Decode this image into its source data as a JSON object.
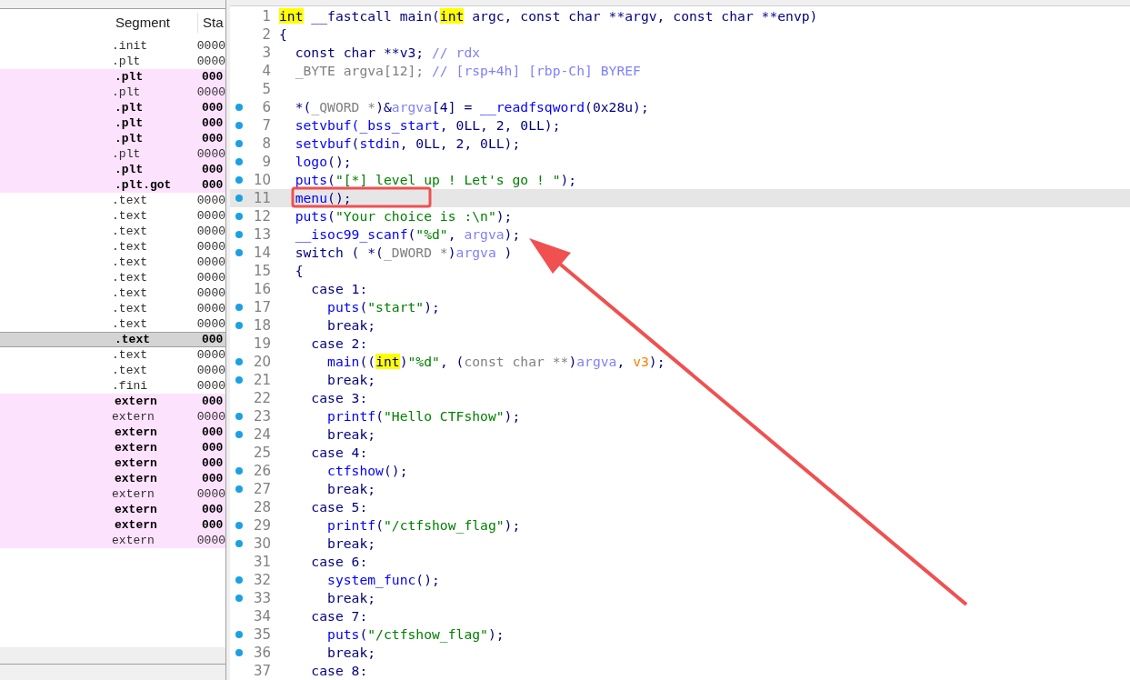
{
  "segments_table": {
    "columns": [
      "Segment",
      "Sta"
    ],
    "rows": [
      {
        "segment": ".init",
        "start": "0000",
        "bold": false,
        "imported": false,
        "selected": false
      },
      {
        "segment": ".plt",
        "start": "0000",
        "bold": false,
        "imported": false,
        "selected": false
      },
      {
        "segment": ".plt",
        "start": "000",
        "bold": true,
        "imported": true,
        "selected": false
      },
      {
        "segment": ".plt",
        "start": "0000",
        "bold": false,
        "imported": true,
        "selected": false
      },
      {
        "segment": ".plt",
        "start": "000",
        "bold": true,
        "imported": true,
        "selected": false
      },
      {
        "segment": ".plt",
        "start": "000",
        "bold": true,
        "imported": true,
        "selected": false
      },
      {
        "segment": ".plt",
        "start": "000",
        "bold": true,
        "imported": true,
        "selected": false
      },
      {
        "segment": ".plt",
        "start": "0000",
        "bold": false,
        "imported": true,
        "selected": false
      },
      {
        "segment": ".plt",
        "start": "000",
        "bold": true,
        "imported": true,
        "selected": false
      },
      {
        "segment": ".plt.got",
        "start": "000",
        "bold": true,
        "imported": true,
        "selected": false
      },
      {
        "segment": ".text",
        "start": "0000",
        "bold": false,
        "imported": false,
        "selected": false
      },
      {
        "segment": ".text",
        "start": "0000",
        "bold": false,
        "imported": false,
        "selected": false
      },
      {
        "segment": ".text",
        "start": "0000",
        "bold": false,
        "imported": false,
        "selected": false
      },
      {
        "segment": ".text",
        "start": "0000",
        "bold": false,
        "imported": false,
        "selected": false
      },
      {
        "segment": ".text",
        "start": "0000",
        "bold": false,
        "imported": false,
        "selected": false
      },
      {
        "segment": ".text",
        "start": "0000",
        "bold": false,
        "imported": false,
        "selected": false
      },
      {
        "segment": ".text",
        "start": "0000",
        "bold": false,
        "imported": false,
        "selected": false
      },
      {
        "segment": ".text",
        "start": "0000",
        "bold": false,
        "imported": false,
        "selected": false
      },
      {
        "segment": ".text",
        "start": "0000",
        "bold": false,
        "imported": false,
        "selected": false
      },
      {
        "segment": ".text",
        "start": "000",
        "bold": true,
        "imported": false,
        "selected": true
      },
      {
        "segment": ".text",
        "start": "0000",
        "bold": false,
        "imported": false,
        "selected": false
      },
      {
        "segment": ".text",
        "start": "0000",
        "bold": false,
        "imported": false,
        "selected": false
      },
      {
        "segment": ".fini",
        "start": "0000",
        "bold": false,
        "imported": false,
        "selected": false
      },
      {
        "segment": "extern",
        "start": "000",
        "bold": true,
        "imported": true,
        "selected": false
      },
      {
        "segment": "extern",
        "start": "0000",
        "bold": false,
        "imported": true,
        "selected": false
      },
      {
        "segment": "extern",
        "start": "000",
        "bold": true,
        "imported": true,
        "selected": false
      },
      {
        "segment": "extern",
        "start": "000",
        "bold": true,
        "imported": true,
        "selected": false
      },
      {
        "segment": "extern",
        "start": "000",
        "bold": true,
        "imported": true,
        "selected": false
      },
      {
        "segment": "extern",
        "start": "000",
        "bold": true,
        "imported": true,
        "selected": false
      },
      {
        "segment": "extern",
        "start": "0000",
        "bold": false,
        "imported": true,
        "selected": false
      },
      {
        "segment": "extern",
        "start": "000",
        "bold": true,
        "imported": true,
        "selected": false
      },
      {
        "segment": "extern",
        "start": "000",
        "bold": true,
        "imported": true,
        "selected": false
      },
      {
        "segment": "extern",
        "start": "0000",
        "bold": false,
        "imported": true,
        "selected": false
      }
    ]
  },
  "pseudocode": {
    "lines": [
      {
        "number": "1",
        "dot": false,
        "selected": false,
        "tokens": [
          {
            "kind": "keyword",
            "text": "int"
          },
          {
            "kind": "plain",
            "text": " __fastcall main("
          },
          {
            "kind": "keyword",
            "text": "int"
          },
          {
            "kind": "plain",
            "text": " argc, const char **argv, const char **envp)"
          }
        ]
      },
      {
        "number": "2",
        "dot": false,
        "selected": false,
        "tokens": [
          {
            "kind": "plain",
            "text": "{"
          }
        ]
      },
      {
        "number": "3",
        "dot": false,
        "selected": false,
        "tokens": [
          {
            "kind": "plain",
            "text": "  const char **v3; "
          },
          {
            "kind": "comment",
            "text": "// rdx"
          }
        ]
      },
      {
        "number": "4",
        "dot": false,
        "selected": false,
        "tokens": [
          {
            "kind": "type",
            "text": "  _BYTE argva[12]; "
          },
          {
            "kind": "comment",
            "text": "// [rsp+4h] [rbp-Ch] BYREF"
          }
        ]
      },
      {
        "number": "5",
        "dot": false,
        "selected": false
      },
      {
        "number": "6",
        "dot": true,
        "selected": false,
        "tokens": [
          {
            "kind": "plain",
            "text": "  *("
          },
          {
            "kind": "type",
            "text": "_QWORD *"
          },
          {
            "kind": "plain",
            "text": ")&"
          },
          {
            "kind": "variable",
            "text": "argva"
          },
          {
            "kind": "plain",
            "text": "[4] = "
          },
          {
            "kind": "function",
            "text": "__readfsqword"
          },
          {
            "kind": "plain",
            "text": "(0x28u);"
          }
        ]
      },
      {
        "number": "7",
        "dot": true,
        "selected": false,
        "tokens": [
          {
            "kind": "function",
            "text": "  setvbuf(_bss_start"
          },
          {
            "kind": "plain",
            "text": ", 0LL, 2, 0LL);"
          }
        ]
      },
      {
        "number": "8",
        "dot": true,
        "selected": false,
        "tokens": [
          {
            "kind": "function",
            "text": "  setvbuf"
          },
          {
            "kind": "plain",
            "text": "("
          },
          {
            "kind": "function",
            "text": "stdin"
          },
          {
            "kind": "plain",
            "text": ", 0LL, 2, 0LL);"
          }
        ]
      },
      {
        "number": "9",
        "dot": true,
        "selected": false,
        "tokens": [
          {
            "kind": "function",
            "text": "  logo"
          },
          {
            "kind": "plain",
            "text": "();"
          }
        ]
      },
      {
        "number": "10",
        "dot": true,
        "selected": false,
        "tokens": [
          {
            "kind": "function",
            "text": "  puts"
          },
          {
            "kind": "plain",
            "text": "("
          },
          {
            "kind": "string",
            "text": "\"[*] level up ! Let's go ! \""
          },
          {
            "kind": "plain",
            "text": ");"
          }
        ]
      },
      {
        "number": "11",
        "dot": true,
        "selected": true,
        "tokens": [
          {
            "kind": "function",
            "text": "  menu"
          },
          {
            "kind": "plain",
            "text": "();"
          }
        ]
      },
      {
        "number": "12",
        "dot": true,
        "selected": false,
        "tokens": [
          {
            "kind": "function",
            "text": "  puts"
          },
          {
            "kind": "plain",
            "text": "("
          },
          {
            "kind": "string",
            "text": "\"Your choice is :\\n\""
          },
          {
            "kind": "plain",
            "text": ");"
          }
        ]
      },
      {
        "number": "13",
        "dot": true,
        "selected": false,
        "tokens": [
          {
            "kind": "function",
            "text": "  __isoc99_scanf"
          },
          {
            "kind": "plain",
            "text": "("
          },
          {
            "kind": "string",
            "text": "\"%d\""
          },
          {
            "kind": "plain",
            "text": ", "
          },
          {
            "kind": "variable",
            "text": "argva"
          },
          {
            "kind": "plain",
            "text": ");"
          }
        ]
      },
      {
        "number": "14",
        "dot": true,
        "selected": false,
        "tokens": [
          {
            "kind": "plain",
            "text": "  switch ( *("
          },
          {
            "kind": "type",
            "text": "_DWORD *"
          },
          {
            "kind": "plain",
            "text": ")"
          },
          {
            "kind": "variable",
            "text": "argva"
          },
          {
            "kind": "plain",
            "text": " )"
          }
        ]
      },
      {
        "number": "15",
        "dot": false,
        "selected": false,
        "tokens": [
          {
            "kind": "plain",
            "text": "  {"
          }
        ]
      },
      {
        "number": "16",
        "dot": false,
        "selected": false,
        "tokens": [
          {
            "kind": "plain",
            "text": "    case 1:"
          }
        ]
      },
      {
        "number": "17",
        "dot": true,
        "selected": false,
        "tokens": [
          {
            "kind": "function",
            "text": "      puts"
          },
          {
            "kind": "plain",
            "text": "("
          },
          {
            "kind": "string",
            "text": "\"start\""
          },
          {
            "kind": "plain",
            "text": ");"
          }
        ]
      },
      {
        "number": "18",
        "dot": true,
        "selected": false,
        "tokens": [
          {
            "kind": "plain",
            "text": "      break;"
          }
        ]
      },
      {
        "number": "19",
        "dot": false,
        "selected": false,
        "tokens": [
          {
            "kind": "plain",
            "text": "    case 2:"
          }
        ]
      },
      {
        "number": "20",
        "dot": true,
        "selected": false,
        "tokens": [
          {
            "kind": "function",
            "text": "      main"
          },
          {
            "kind": "plain",
            "text": "(("
          },
          {
            "kind": "keyword",
            "text": "int"
          },
          {
            "kind": "plain",
            "text": ")"
          },
          {
            "kind": "string",
            "text": "\"%d\""
          },
          {
            "kind": "plain",
            "text": ", ("
          },
          {
            "kind": "type",
            "text": "const char **"
          },
          {
            "kind": "plain",
            "text": ")"
          },
          {
            "kind": "variable",
            "text": "argva"
          },
          {
            "kind": "plain",
            "text": ", "
          },
          {
            "kind": "local",
            "text": "v3"
          },
          {
            "kind": "plain",
            "text": ");"
          }
        ]
      },
      {
        "number": "21",
        "dot": true,
        "selected": false,
        "tokens": [
          {
            "kind": "plain",
            "text": "      break;"
          }
        ]
      },
      {
        "number": "22",
        "dot": false,
        "selected": false,
        "tokens": [
          {
            "kind": "plain",
            "text": "    case 3:"
          }
        ]
      },
      {
        "number": "23",
        "dot": true,
        "selected": false,
        "tokens": [
          {
            "kind": "function",
            "text": "      printf"
          },
          {
            "kind": "plain",
            "text": "("
          },
          {
            "kind": "string",
            "text": "\"Hello CTFshow\""
          },
          {
            "kind": "plain",
            "text": ");"
          }
        ]
      },
      {
        "number": "24",
        "dot": true,
        "selected": false,
        "tokens": [
          {
            "kind": "plain",
            "text": "      break;"
          }
        ]
      },
      {
        "number": "25",
        "dot": false,
        "selected": false,
        "tokens": [
          {
            "kind": "plain",
            "text": "    case 4:"
          }
        ]
      },
      {
        "number": "26",
        "dot": true,
        "selected": false,
        "tokens": [
          {
            "kind": "function",
            "text": "      ctfshow"
          },
          {
            "kind": "plain",
            "text": "();"
          }
        ]
      },
      {
        "number": "27",
        "dot": true,
        "selected": false,
        "tokens": [
          {
            "kind": "plain",
            "text": "      break;"
          }
        ]
      },
      {
        "number": "28",
        "dot": false,
        "selected": false,
        "tokens": [
          {
            "kind": "plain",
            "text": "    case 5:"
          }
        ]
      },
      {
        "number": "29",
        "dot": true,
        "selected": false,
        "tokens": [
          {
            "kind": "function",
            "text": "      printf"
          },
          {
            "kind": "plain",
            "text": "("
          },
          {
            "kind": "string",
            "text": "\"/ctfshow_flag\""
          },
          {
            "kind": "plain",
            "text": ");"
          }
        ]
      },
      {
        "number": "30",
        "dot": true,
        "selected": false,
        "tokens": [
          {
            "kind": "plain",
            "text": "      break;"
          }
        ]
      },
      {
        "number": "31",
        "dot": false,
        "selected": false,
        "tokens": [
          {
            "kind": "plain",
            "text": "    case 6:"
          }
        ]
      },
      {
        "number": "32",
        "dot": true,
        "selected": false,
        "tokens": [
          {
            "kind": "function",
            "text": "      system_func"
          },
          {
            "kind": "plain",
            "text": "();"
          }
        ]
      },
      {
        "number": "33",
        "dot": true,
        "selected": false,
        "tokens": [
          {
            "kind": "plain",
            "text": "      break;"
          }
        ]
      },
      {
        "number": "34",
        "dot": false,
        "selected": false,
        "tokens": [
          {
            "kind": "plain",
            "text": "    case 7:"
          }
        ]
      },
      {
        "number": "35",
        "dot": true,
        "selected": false,
        "tokens": [
          {
            "kind": "function",
            "text": "      puts"
          },
          {
            "kind": "plain",
            "text": "("
          },
          {
            "kind": "string",
            "text": "\"/ctfshow_flag\""
          },
          {
            "kind": "plain",
            "text": ");"
          }
        ]
      },
      {
        "number": "36",
        "dot": true,
        "selected": false,
        "tokens": [
          {
            "kind": "plain",
            "text": "      break;"
          }
        ]
      },
      {
        "number": "37",
        "dot": false,
        "selected": false,
        "tokens": [
          {
            "kind": "plain",
            "text": "    case 8:"
          }
        ]
      }
    ]
  }
}
